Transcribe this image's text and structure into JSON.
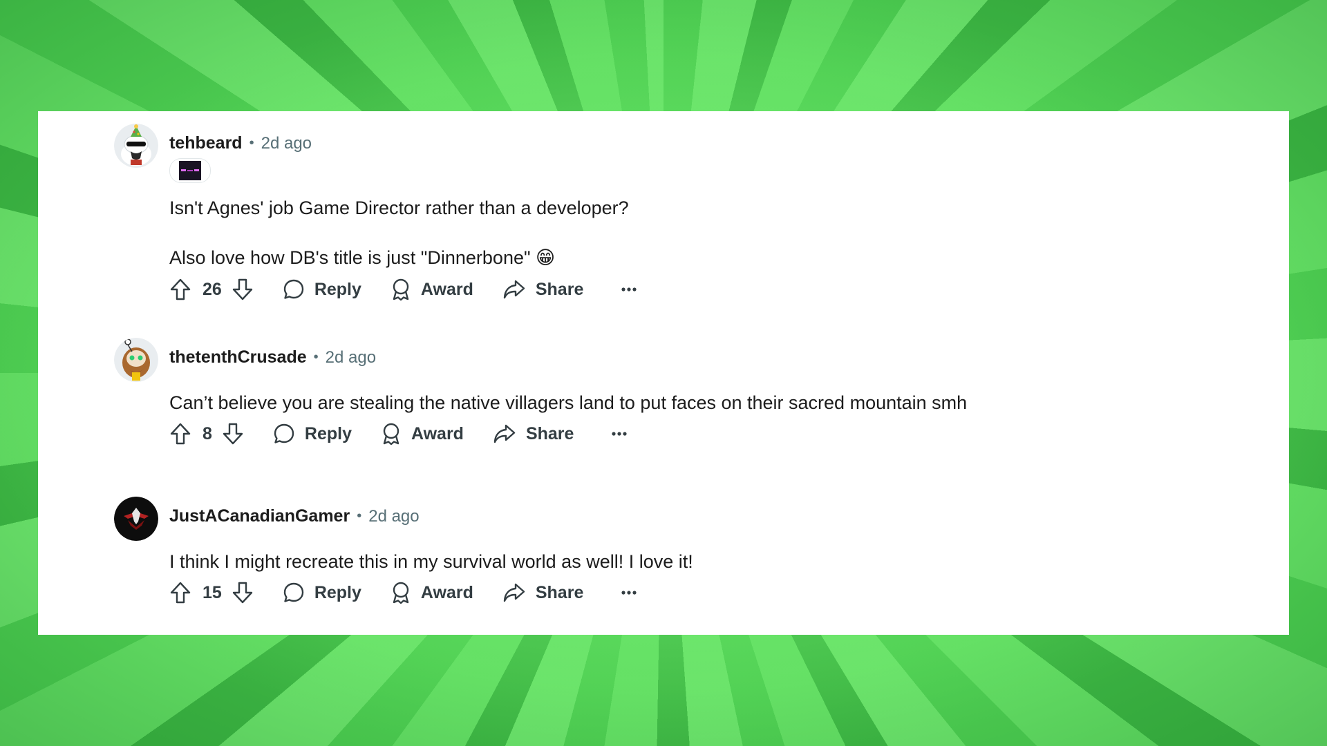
{
  "comments": [
    {
      "username": "tehbeard",
      "separator": "•",
      "time": "2d ago",
      "has_flair": true,
      "flair_icon": "enderman-flair-icon",
      "avatar_icon": "snoo-avatar-party-hat-icon",
      "body": [
        "Isn't Agnes' job Game Director rather than a developer?",
        "Also love how DB's title is just \"Dinnerbone\" 😁"
      ],
      "votes": "26",
      "reply_label": "Reply",
      "award_label": "Award",
      "share_label": "Share"
    },
    {
      "username": "thetenthCrusade",
      "separator": "•",
      "time": "2d ago",
      "has_flair": false,
      "avatar_icon": "snoo-avatar-bearded-icon",
      "body": [
        "Can’t believe you are stealing the native villagers land to put faces on their sacred mountain smh"
      ],
      "votes": "8",
      "reply_label": "Reply",
      "award_label": "Award",
      "share_label": "Share"
    },
    {
      "username": "JustACanadianGamer",
      "separator": "•",
      "time": "2d ago",
      "has_flair": false,
      "avatar_icon": "dark-emblem-avatar-icon",
      "body": [
        "I think I might recreate this in my survival world as well! I love it!"
      ],
      "votes": "15",
      "reply_label": "Reply",
      "award_label": "Award",
      "share_label": "Share"
    }
  ],
  "colors": {
    "text_primary": "#1c1c1c",
    "text_meta": "#576f76",
    "action_text": "#333d42",
    "panel_bg": "#ffffff",
    "background_green": "#6fe86f"
  }
}
